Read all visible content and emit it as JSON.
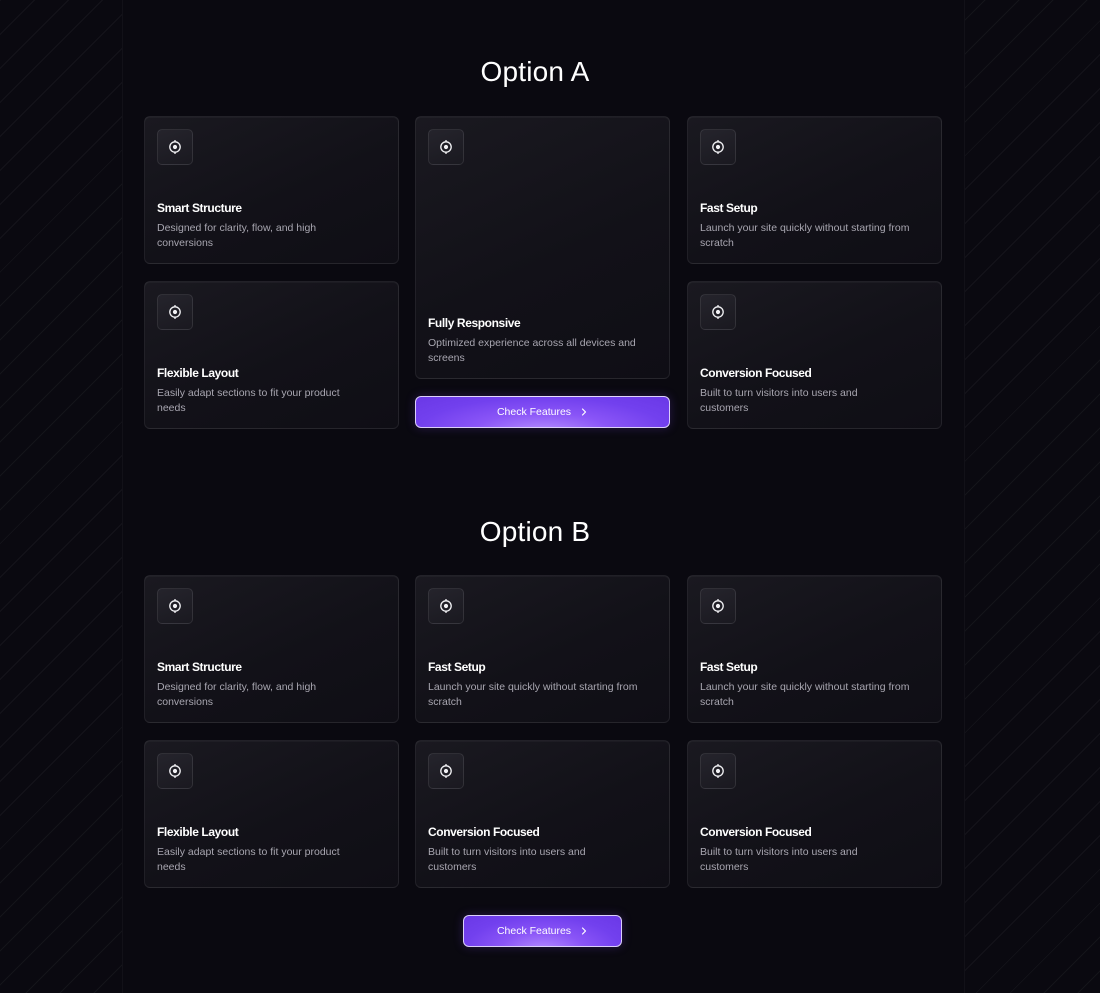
{
  "theme": {
    "background": "#0a0910",
    "card_background": "#14131a",
    "accent": "#7c45f2",
    "text_primary": "#ffffff",
    "text_secondary": "#a8a6b0"
  },
  "sections": [
    {
      "title": "Option A",
      "cards": [
        {
          "icon": "target-icon",
          "title": "Smart Structure",
          "description": "Designed for clarity, flow, and high conversions"
        },
        {
          "icon": "target-icon",
          "title": "Fully Responsive",
          "description": "Optimized experience across all devices and screens"
        },
        {
          "icon": "target-icon",
          "title": "Fast Setup",
          "description": "Launch your site quickly without starting from scratch"
        },
        {
          "icon": "target-icon",
          "title": "Flexible Layout",
          "description": "Easily adapt sections to fit your product needs"
        },
        {
          "icon": "target-icon",
          "title": "Conversion Focused",
          "description": "Built to turn visitors into users and customers"
        }
      ],
      "button": {
        "label": "Check Features",
        "icon": "chevron-right-icon"
      }
    },
    {
      "title": "Option B",
      "cards": [
        {
          "icon": "target-icon",
          "title": "Smart Structure",
          "description": "Designed for clarity, flow, and high conversions"
        },
        {
          "icon": "target-icon",
          "title": "Fast Setup",
          "description": "Launch your site quickly without starting from scratch"
        },
        {
          "icon": "target-icon",
          "title": "Fast Setup",
          "description": "Launch your site quickly without starting from scratch"
        },
        {
          "icon": "target-icon",
          "title": "Flexible Layout",
          "description": "Easily adapt sections to fit your product needs"
        },
        {
          "icon": "target-icon",
          "title": "Conversion Focused",
          "description": "Built to turn visitors into users and customers"
        },
        {
          "icon": "target-icon",
          "title": "Conversion Focused",
          "description": "Built to turn visitors into users and customers"
        }
      ],
      "button": {
        "label": "Check Features",
        "icon": "chevron-right-icon"
      }
    }
  ]
}
